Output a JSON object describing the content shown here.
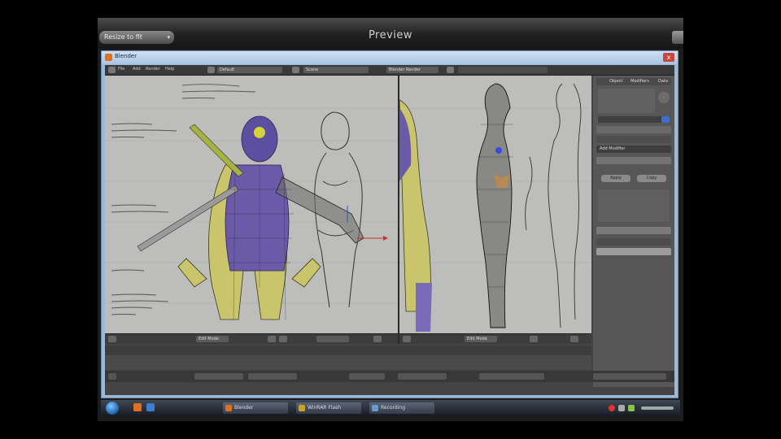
{
  "preview_window": {
    "title": "Preview",
    "dropdown_label": "Resize to fit"
  },
  "blender_window": {
    "title": "Blender",
    "close_glyph": "x",
    "header_menus": [
      "File",
      "Add",
      "Render",
      "Help"
    ],
    "scene_label": "Default",
    "layout_label": "Scene",
    "engine_label": "Blender Render"
  },
  "viewports": {
    "front": {
      "mode_label": "Edit Mode",
      "annotations": [
        "THE HARD WAY, OR THE LONGER APPROACH",
        "HANDS COME UP TO THE BODY",
        "LOWER DOWN",
        "PARTS FOR BEACH"
      ]
    },
    "side": {
      "mode_label": "Edit Mode"
    }
  },
  "properties_panel": {
    "tabs": [
      "Object",
      "Modifiers",
      "Data"
    ],
    "buttons": [
      "Apply",
      "Copy"
    ],
    "dropdown_label": "Add Modifier"
  },
  "taskbar": {
    "items": [
      {
        "label": "Blender",
        "icon_color": "#e07020"
      },
      {
        "label": "WinRAR Flash",
        "icon_color": "#c9a227"
      },
      {
        "label": "Recording",
        "icon_color": "#6a9bd1"
      }
    ]
  },
  "colors": {
    "mesh_purple": "#6a5aa8",
    "mesh_yellow": "#c8c46a",
    "reference_bg": "#b8b8b6"
  }
}
